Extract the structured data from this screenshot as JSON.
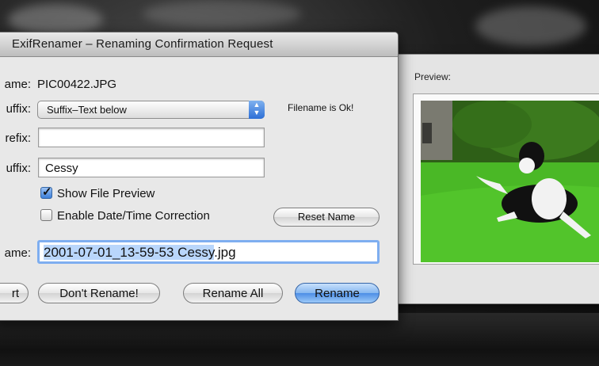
{
  "dialog": {
    "title": "ExifRenamer  –  Renaming Confirmation Request",
    "name_label": "ame:",
    "name_value": "PIC00422.JPG",
    "suffix_mode_label": "uffix:",
    "suffix_mode_value": "Suffix–Text below",
    "status": "Filename is Ok!",
    "prefix_label": "refix:",
    "prefix_value": "",
    "suffix_label": "uffix:",
    "suffix_value": "Cessy",
    "show_preview_label": "Show File Preview",
    "show_preview_checked": true,
    "date_correction_label": "Enable Date/Time Correction",
    "date_correction_checked": false,
    "reset_button": "Reset Name",
    "newname_label": "ame:",
    "newname_selected": "2001-07-01_13-59-53 Cessy",
    "newname_rest": ".jpg",
    "buttons": {
      "abort": "rt",
      "dont_rename": "Don't Rename!",
      "rename_all": "Rename All",
      "rename": "Rename"
    }
  },
  "preview": {
    "label": "Preview:"
  }
}
